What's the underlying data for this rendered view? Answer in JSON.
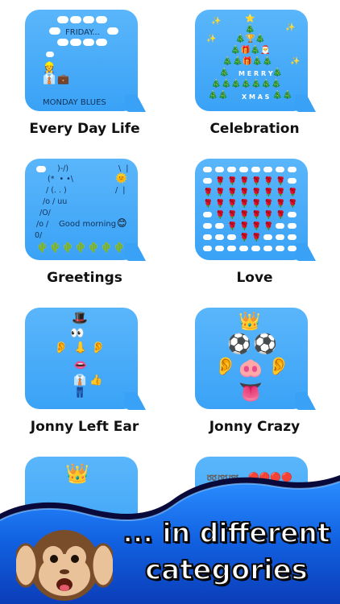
{
  "categories": [
    {
      "name": "Every Day Life"
    },
    {
      "name": "Celebration"
    },
    {
      "name": "Greetings"
    },
    {
      "name": "Love"
    },
    {
      "name": "Jonny Left Ear"
    },
    {
      "name": "Jonny Crazy"
    }
  ],
  "bubble_text": {
    "friday": "FRIDAY...",
    "monday": "MONDAY BLUES",
    "merry": "M E R R Y",
    "xmas": "X M A S",
    "greet_l1": ")-/)",
    "greet_l2": "(*  • •\\",
    "greet_l3": "/ (. . )",
    "greet_l4": "/o / uu",
    "greet_l5": "/O/",
    "greet_l6": "/o /",
    "greet_l7": "0/",
    "greet_r1": "\\  |",
    "greet_r2": "/  |",
    "good_morning": "Good morning"
  },
  "promo": {
    "line1": "... in different",
    "line2": "categories"
  },
  "colors": {
    "bubble": "#3aa2f6",
    "banner_blue": "#1a6fe8",
    "banner_dark": "#0a0a40"
  },
  "icons": [
    "cloud-icon",
    "worker-icon",
    "briefcase-icon",
    "tree-icon",
    "star-icon",
    "rose-icon",
    "top-hat-icon",
    "crown-icon",
    "soccer-ball-icon",
    "ear-icon",
    "pig-nose-icon",
    "tongue-icon",
    "monkey-icon"
  ]
}
